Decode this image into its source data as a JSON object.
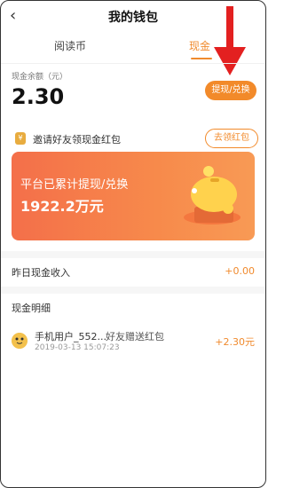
{
  "header": {
    "title": "我的钱包",
    "back_glyph": "‹"
  },
  "tabs": [
    {
      "label": "阅读币"
    },
    {
      "label": "现金"
    }
  ],
  "balance": {
    "label": "现金余额（元）",
    "amount": "2.30",
    "button_label": "提现/兑换"
  },
  "invite": {
    "text": "邀请好友领现金红包",
    "button_label": "去领红包",
    "icon": "coin-icon"
  },
  "banner": {
    "title": "平台已累计提现/兑换",
    "amount": "1922.2万元",
    "icon": "piggy-bank-icon"
  },
  "yesterday": {
    "label": "昨日现金收入",
    "value": "+0.00"
  },
  "details": {
    "header": "现金明细",
    "items": [
      {
        "user": "手机用户_552...",
        "reason": "好友赠送红包",
        "time": "2019-03-13 15:07:23",
        "amount": "+2.30元"
      }
    ]
  },
  "colors": {
    "accent": "#f28a2a",
    "banner_start": "#f46f4a",
    "banner_end": "#f89a55",
    "arrow": "#e32020"
  }
}
